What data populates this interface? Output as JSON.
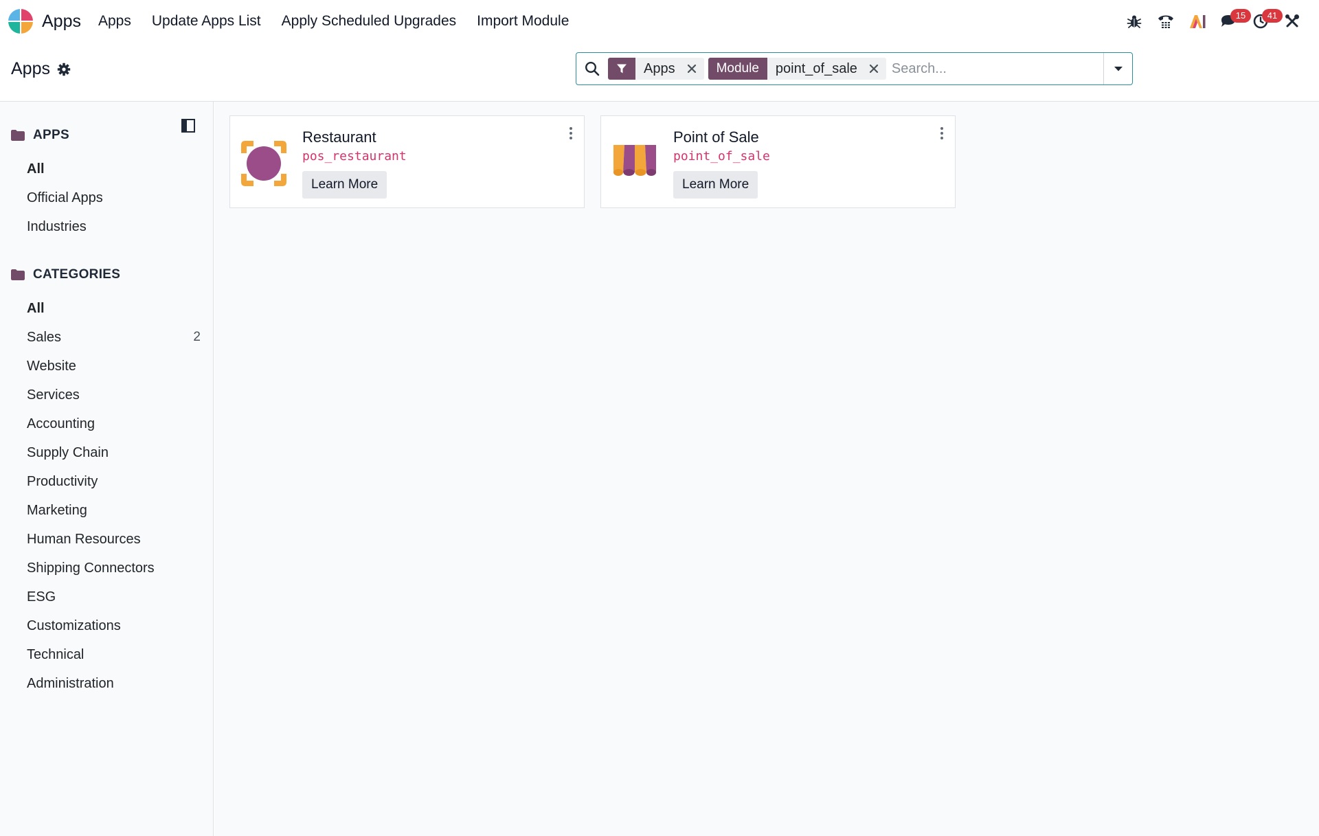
{
  "navbar": {
    "brand": "Apps",
    "menu": [
      {
        "label": "Apps"
      },
      {
        "label": "Update Apps List"
      },
      {
        "label": "Apply Scheduled Upgrades"
      },
      {
        "label": "Import Module"
      }
    ],
    "systray": {
      "messages_count": "15",
      "activities_count": "41"
    }
  },
  "control_panel": {
    "title": "Apps",
    "search": {
      "facets": [
        {
          "tag": "filter-icon",
          "value": "Apps"
        },
        {
          "tag": "Module",
          "value": "point_of_sale"
        }
      ],
      "placeholder": "Search..."
    }
  },
  "sidebar": {
    "apps_section": {
      "title": "APPS",
      "items": [
        {
          "label": "All",
          "active": true
        },
        {
          "label": "Official Apps"
        },
        {
          "label": "Industries"
        }
      ]
    },
    "categories_section": {
      "title": "CATEGORIES",
      "items": [
        {
          "label": "All",
          "active": true
        },
        {
          "label": "Sales",
          "count": "2"
        },
        {
          "label": "Website"
        },
        {
          "label": "Services"
        },
        {
          "label": "Accounting"
        },
        {
          "label": "Supply Chain"
        },
        {
          "label": "Productivity"
        },
        {
          "label": "Marketing"
        },
        {
          "label": "Human Resources"
        },
        {
          "label": "Shipping Connectors"
        },
        {
          "label": "ESG"
        },
        {
          "label": "Customizations"
        },
        {
          "label": "Technical"
        },
        {
          "label": "Administration"
        }
      ]
    }
  },
  "cards": [
    {
      "title": "Restaurant",
      "technical_name": "pos_restaurant",
      "button": "Learn More",
      "icon": "restaurant-icon"
    },
    {
      "title": "Point of Sale",
      "technical_name": "point_of_sale",
      "button": "Learn More",
      "icon": "point-of-sale-icon"
    }
  ],
  "colors": {
    "brand": "#714b67",
    "accent": "#2a8f9b",
    "badge": "#d9363e",
    "technical_name": "#d6336c"
  }
}
